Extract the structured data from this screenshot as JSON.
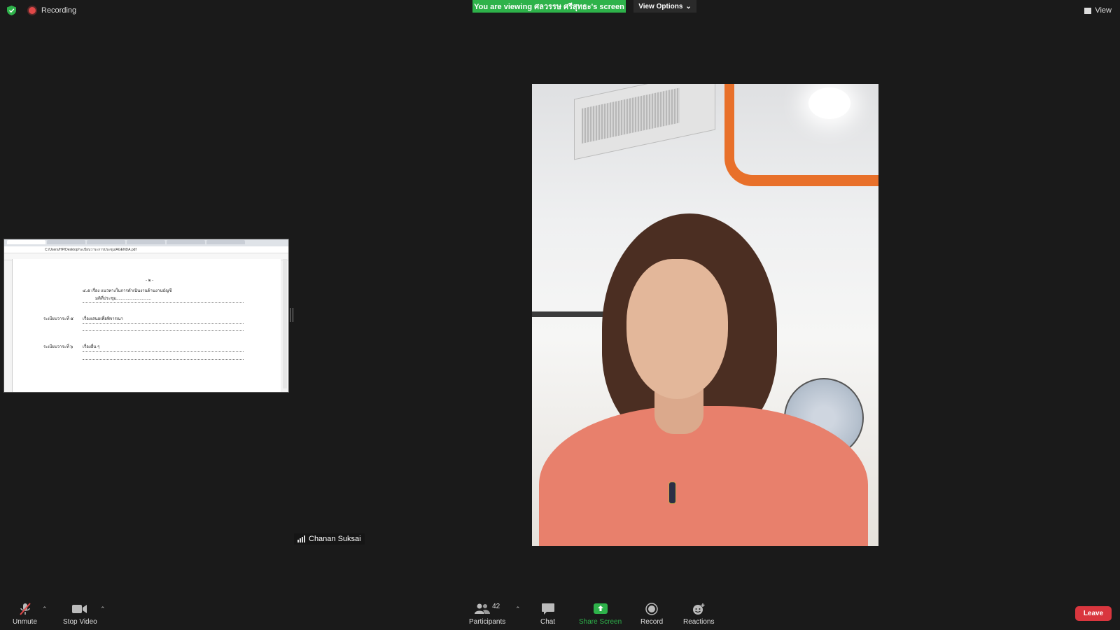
{
  "topbar": {
    "recording_label": "Recording",
    "viewing_banner": "You are viewing ศลวรรษ ศรีสุทธะ's screen",
    "view_options_label": "View Options",
    "view_label": "View"
  },
  "shared_screen": {
    "url": "C:/Users/HP/Desktop/ระเบียบวาระการประชุม/AGENDA.pdf",
    "lines": {
      "page_number": "- ๒ -",
      "item_4_5": "๔.๕   เรื่อง  แนวทางในการดำเนินงานด้านงานบัญชี",
      "item_4_5_resolution": "มติที่ประชุม..............................",
      "agenda_5_label": "ระเบียบวาระที่ ๕",
      "agenda_5_text": "เรื่องเสนอเพื่อพิจารณา",
      "agenda_6_label": "ระเบียบวาระที่ ๖",
      "agenda_6_text": "เรื่องอื่น ๆ"
    }
  },
  "participant": {
    "name": "Chanan Suksai"
  },
  "toolbar": {
    "unmute_label": "Unmute",
    "stop_video_label": "Stop Video",
    "participants_label": "Participants",
    "participants_count": "42",
    "chat_label": "Chat",
    "share_screen_label": "Share Screen",
    "record_label": "Record",
    "reactions_label": "Reactions",
    "leave_label": "Leave"
  },
  "colors": {
    "banner_green": "#2eb24a",
    "leave_red": "#d9363e",
    "background": "#1a1a1a"
  }
}
